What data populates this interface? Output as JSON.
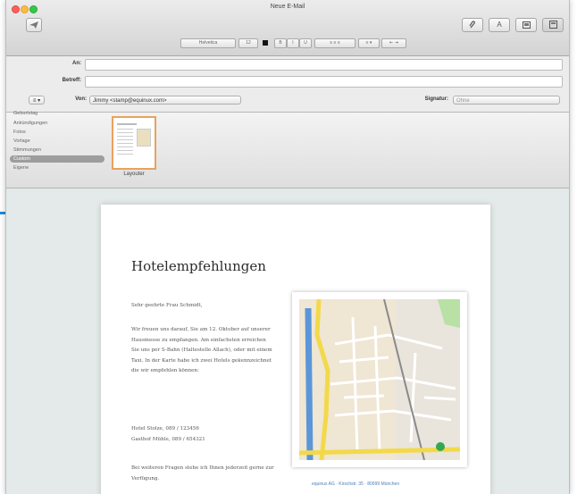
{
  "window": {
    "title": "Neue E-Mail"
  },
  "toolbar": {
    "send_icon": "paper-plane-icon",
    "attach_icon": "paperclip-icon",
    "font_button_label": "A",
    "photo_browser_icon": "photo-icon",
    "stationery_icon": "stationery-icon"
  },
  "format_bar": {
    "font_name": "Helvetica",
    "font_size": "12",
    "bold": "B",
    "italic": "I",
    "underline": "U",
    "list": "≡ ▾",
    "indent": "⇤ ⇥"
  },
  "header": {
    "to_label": "An:",
    "subject_label": "Betreff:",
    "from_label": "Von:",
    "from_value": "Jimmy <stamp@equinux.com>",
    "signature_label": "Signatur:",
    "signature_value": "Ohne"
  },
  "stationery": {
    "categories": [
      "Geburtstag",
      "Ankündigungen",
      "Fotos",
      "Vorlage",
      "Stimmungen",
      "Custom",
      "Eigene"
    ],
    "selected_index": 5,
    "template_name": "Layouter"
  },
  "email": {
    "heading": "Hotelempfehlungen",
    "greeting": "Sehr geehrte Frau Schmidt,",
    "body1": "Wir freuen uns darauf, Sie am 12. Oktober auf unserer Hausmesse zu empfangen. Am einfachsten erreichen Sie uns per S-Bahn (Haltestelle Allach), oder mit einem Taxi. In der Karte habe ich zwei Hotels gekennzeichnet die wir empfehlen können:",
    "hotels": "Hotel Stolze, 089 / 123456\nGasthof Mühle, 089 / 654321",
    "closing": "Bei weiteren Fragen stehe ich Ihnen jederzeit gerne zur Verfügung.",
    "map_address": "equinux AG · Kirschstr. 35 · 80999 München"
  },
  "colors": {
    "accent": "#1c8ae0",
    "map_road": "#f3d94a",
    "map_water": "#5b96d8",
    "map_park": "#b9e0a5"
  }
}
